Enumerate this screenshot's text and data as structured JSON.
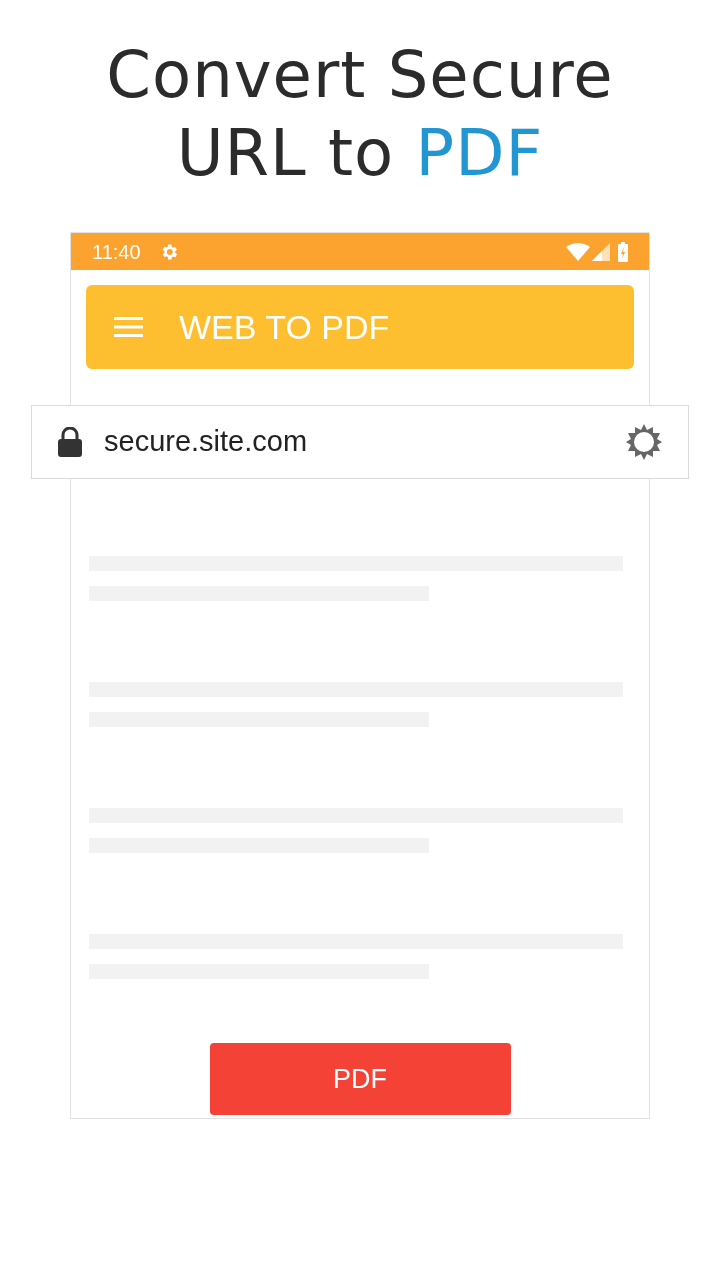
{
  "headline": {
    "text": "Convert Secure URL to",
    "highlight": "PDF"
  },
  "status_bar": {
    "time": "11:40"
  },
  "toolbar": {
    "title": "WEB TO PDF"
  },
  "address_bar": {
    "url": "secure.site.com"
  },
  "pdf_button": {
    "label": "PDF"
  }
}
